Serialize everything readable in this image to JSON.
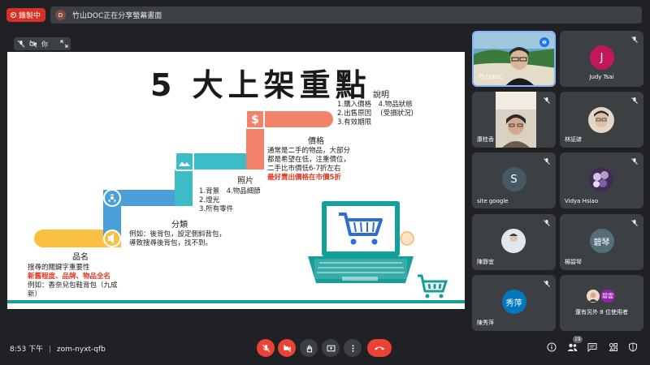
{
  "recording": {
    "label": "錄製中"
  },
  "share_banner": {
    "avatar_letter": "D",
    "text": "竹山DOC正在分享螢幕畫面"
  },
  "presenter": {
    "label": "你"
  },
  "slide": {
    "title": "5 大上架重點",
    "sections": {
      "name": {
        "heading": "品名",
        "line1": "搜尋的關鍵字重要性",
        "line2": "新舊程度、品牌、物品全名",
        "line3": "例如：香奈兒包鞋背包（九成",
        "line4": "新）"
      },
      "category": {
        "heading": "分類",
        "line1": "例如：後背包，設定側斜背包，",
        "line2": "導致搜尋後背包，找不到。"
      },
      "photo": {
        "heading": "照片",
        "line1": "1.背景　4.物品細節",
        "line2": "2.燈光",
        "line3": "3.所有零件"
      },
      "price": {
        "heading": "價格",
        "line1": "通常是二手的物品，大部分",
        "line2": "都是希望在低，注重價位，",
        "line3": "二手比市價低6-7折左右",
        "line4": "最好賣出價格在市價5折"
      },
      "desc": {
        "heading": "說明",
        "line1": "1.購入價格　4.物品狀態",
        "line2": "2.出售原因　 (受損狀況)",
        "line3": "3.有效期限"
      }
    },
    "colors": {
      "name_bar": "#f9c043",
      "category_bar": "#4a9fd8",
      "photo_bar": "#3cbcc6",
      "price_bar": "#f2826a",
      "laptop": "#159e9a",
      "cart": "#2c6fd0"
    }
  },
  "participants": [
    {
      "name": "竹山DOC",
      "type": "video"
    },
    {
      "name": "Judy Tsai",
      "initial": "J",
      "color": "#c2185b"
    },
    {
      "name": "康桂香",
      "type": "video"
    },
    {
      "name": "林証諺",
      "type": "video"
    },
    {
      "name": "site google",
      "initial": "S",
      "color": "#455a64"
    },
    {
      "name": "Vidya Hsiao",
      "type": "photo"
    },
    {
      "name": "陳靜宜",
      "type": "photo"
    },
    {
      "name": "楊碧琴",
      "initial": "碧琴",
      "color": "#546e7a"
    },
    {
      "name": "陳秀萍",
      "initial": "秀萍",
      "color": "#0277bd"
    },
    {
      "name": "還有另外 8 位使用者",
      "initial": "碧雲",
      "color": "#8e24aa"
    }
  ],
  "bottom_bar": {
    "time": "8:53 下午",
    "separator": "|",
    "meeting_code": "zom-nyxt-qfb",
    "participant_count": "19"
  },
  "icons": [
    "mic-off-icon",
    "camera-off-icon",
    "raise-hand-icon",
    "present-icon",
    "more-icon",
    "hangup-icon",
    "info-icon",
    "people-icon",
    "chat-icon",
    "activities-icon",
    "expand-icon"
  ]
}
